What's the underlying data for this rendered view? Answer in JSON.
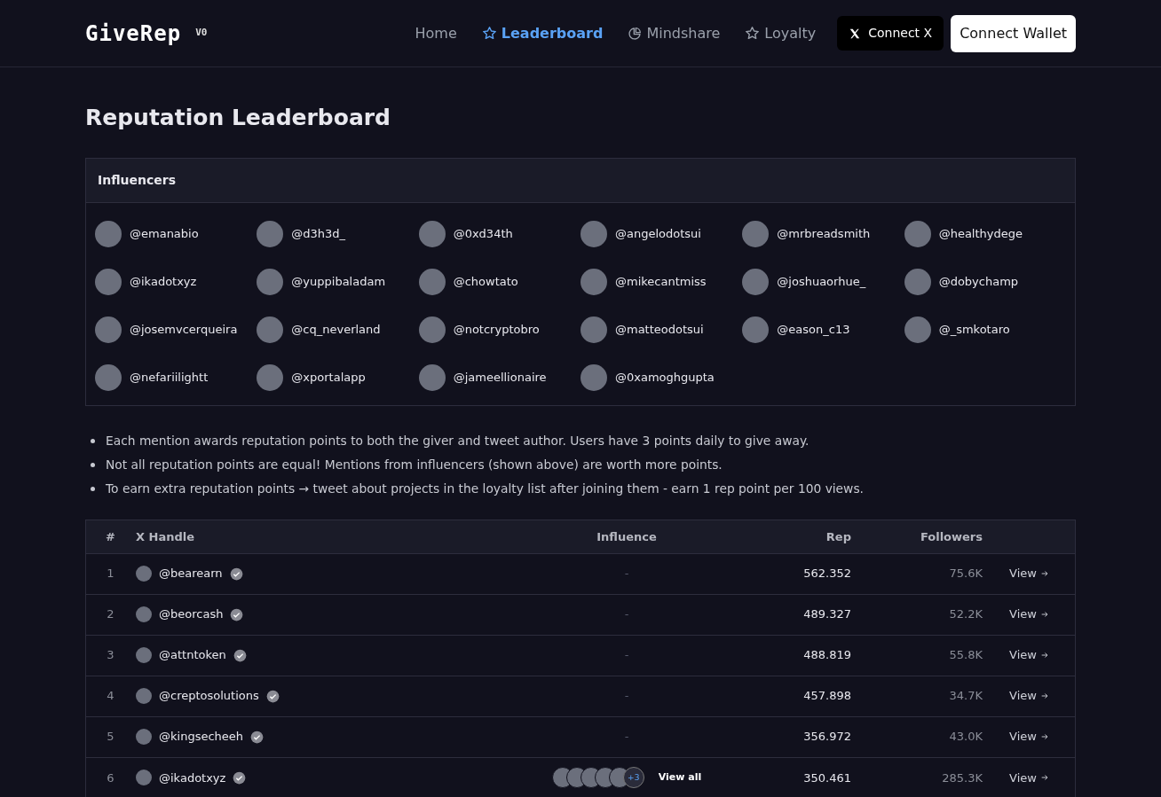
{
  "navbar": {
    "logo": "GiveRep",
    "version": "V0",
    "links": [
      {
        "label": "Home",
        "kind": "plain",
        "selected": false
      },
      {
        "label": "Leaderboard",
        "kind": "star",
        "selected": true
      },
      {
        "label": "Mindshare",
        "kind": "pie",
        "selected": false
      },
      {
        "label": "Loyalty",
        "kind": "star",
        "selected": false
      }
    ],
    "connect_x": "Connect X",
    "connect_wallet": "Connect Wallet"
  },
  "title": "Reputation Leaderboard",
  "influencers": {
    "heading": "Influencers",
    "items": [
      "@emanabio",
      "@d3h3d_",
      "@0xd34th",
      "@angelodotsui",
      "@mrbreadsmith",
      "@healthydege",
      "@ikadotxyz",
      "@yuppibaladam",
      "@chowtato",
      "@mikecantmiss",
      "@joshuaorhue_",
      "@dobychamp",
      "@josemvcerqueira",
      "@cq_neverland",
      "@notcryptobro",
      "@matteodotsui",
      "@eason_c13",
      "@_smkotaro",
      "@nefariilightt",
      "@xportalapp",
      "@jameellionaire",
      "@0xamoghgupta"
    ]
  },
  "notes": [
    "Each mention awards reputation points to both the giver and tweet author. Users have 3 points daily to give away.",
    "Not all reputation points are equal! Mentions from influencers (shown above) are worth more points.",
    "To earn extra reputation points → tweet about projects in the loyalty list after joining them - earn 1 rep point per 100 views."
  ],
  "table": {
    "columns": [
      "#",
      "X Handle",
      "Influence",
      "Rep",
      "Followers"
    ],
    "rows": [
      {
        "rank": "1",
        "handle": "@bearearn",
        "verified": true,
        "influence": "-",
        "rep": "562.352",
        "followers": "75.6K",
        "action": "View"
      },
      {
        "rank": "2",
        "handle": "@beorcash",
        "verified": true,
        "influence": "-",
        "rep": "489.327",
        "followers": "52.2K",
        "action": "View"
      },
      {
        "rank": "3",
        "handle": "@attntoken",
        "verified": true,
        "influence": "-",
        "rep": "488.819",
        "followers": "55.8K",
        "action": "View"
      },
      {
        "rank": "4",
        "handle": "@creptosolutions",
        "verified": true,
        "influence": "-",
        "rep": "457.898",
        "followers": "34.7K",
        "action": "View"
      },
      {
        "rank": "5",
        "handle": "@kingsecheeh",
        "verified": true,
        "influence": "-",
        "rep": "356.972",
        "followers": "43.0K",
        "action": "View"
      },
      {
        "rank": "6",
        "handle": "@ikadotxyz",
        "verified": true,
        "kind": "avatars",
        "influence_more": "+3",
        "influence_link": "View all",
        "rep": "350.461",
        "followers": "285.3K",
        "action": "View"
      }
    ]
  }
}
